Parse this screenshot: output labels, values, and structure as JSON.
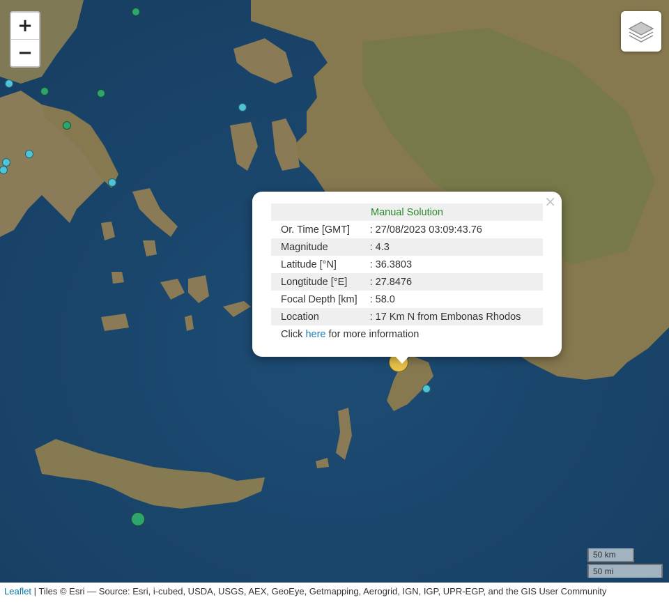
{
  "map": {
    "colors": {
      "sea": "#1f4f78",
      "land": "#8a7a55",
      "popup_title": "#2a8a2a",
      "link": "#1f7ab8"
    },
    "markers": [
      {
        "name": "quake-marker",
        "color": "#2ea56c",
        "selected": false
      },
      {
        "name": "quake-marker",
        "color": "#2ea56c",
        "selected": false
      },
      {
        "name": "quake-marker",
        "color": "#2ea56c",
        "selected": false
      },
      {
        "name": "quake-marker",
        "color": "#2ea56c",
        "selected": false
      },
      {
        "name": "quake-marker",
        "color": "#4fc3d8",
        "selected": false
      },
      {
        "name": "quake-marker",
        "color": "#4fc3d8",
        "selected": false
      },
      {
        "name": "quake-marker",
        "color": "#4fc3d8",
        "selected": false
      },
      {
        "name": "quake-marker",
        "color": "#4fc3d8",
        "selected": false
      },
      {
        "name": "quake-marker",
        "color": "#4fc3d8",
        "selected": false
      },
      {
        "name": "quake-marker",
        "color": "#4fc3d8",
        "selected": false
      },
      {
        "name": "quake-marker",
        "color": "#4fc3d8",
        "selected": false
      },
      {
        "name": "quake-marker",
        "color": "#2ea56c",
        "selected": false
      },
      {
        "name": "quake-marker-selected",
        "color": "#e8c14a",
        "selected": true
      }
    ]
  },
  "controls": {
    "zoom_in": "+",
    "zoom_out": "−",
    "layers_icon": "layers-icon"
  },
  "popup": {
    "title": "Manual Solution",
    "rows": [
      {
        "label": "Or. Time [GMT]",
        "value": ": 27/08/2023 03:09:43.76"
      },
      {
        "label": "Magnitude",
        "value": ": 4.3"
      },
      {
        "label": "Latitude [°N]",
        "value": ": 36.3803"
      },
      {
        "label": "Longtitude [°E]",
        "value": ": 27.8476"
      },
      {
        "label": "Focal Depth [km]",
        "value": ": 58.0"
      },
      {
        "label": "Location",
        "value": ": 17 Km N from Embonas Rhodos"
      }
    ],
    "more_prefix": "Click ",
    "more_link": "here",
    "more_suffix": " for more information",
    "close_icon": "×"
  },
  "scale": {
    "km": "50 km",
    "mi": "50 mi"
  },
  "attribution": {
    "leaflet": "Leaflet",
    "text": " | Tiles © Esri — Source: Esri, i-cubed, USDA, USGS, AEX, GeoEye, Getmapping, Aerogrid, IGN, IGP, UPR-EGP, and the GIS User Community"
  }
}
